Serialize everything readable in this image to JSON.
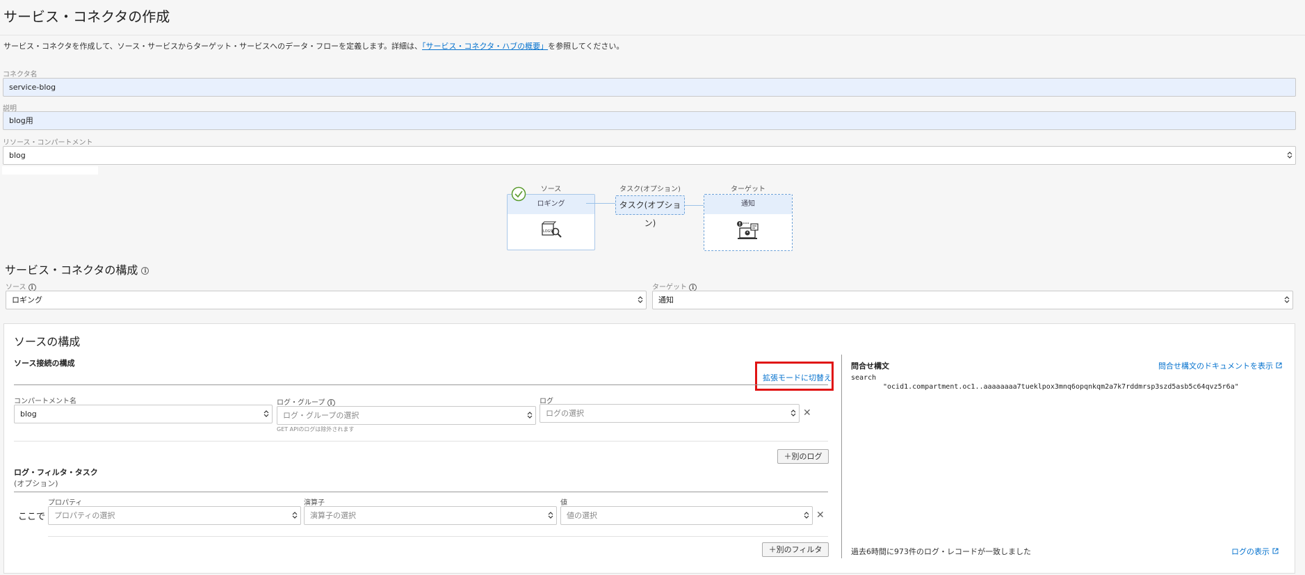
{
  "page": {
    "title": "サービス・コネクタの作成",
    "intro_text": "サービス・コネクタを作成して、ソース・サービスからターゲット・サービスへのデータ・フローを定義します。詳細は、",
    "intro_link": "「サービス・コネクタ・ハブの概要」",
    "intro_suffix": "を参照してください。"
  },
  "form": {
    "connector_name_label": "コネクタ名",
    "connector_name_value": "service-blog",
    "description_label": "説明",
    "description_value": "blog用",
    "compartment_label": "リソース・コンパートメント",
    "compartment_value": "blog"
  },
  "diagram": {
    "source_label": "ソース",
    "source_box": "ロギング",
    "task_label": "タスク(オプション)",
    "task_box": "タスク(オプション)",
    "target_label": "ターゲット",
    "target_box": "通知"
  },
  "config": {
    "heading": "サービス・コネクタの構成",
    "source_label": "ソース",
    "source_value": "ロギング",
    "target_label": "ターゲット",
    "target_value": "通知"
  },
  "source_config": {
    "heading": "ソースの構成",
    "connection_heading": "ソース接続の構成",
    "switch_mode_link": "拡張モードに切替え",
    "compartment_label": "コンパートメント名",
    "compartment_value": "blog",
    "log_group_label": "ログ・グループ",
    "log_group_placeholder": "ログ・グループの選択",
    "log_group_hint": "GET APIのログは除外されます",
    "log_label": "ログ",
    "log_placeholder": "ログの選択",
    "another_log_button": "別のログ",
    "filter_heading": "ログ・フィルタ・タスク",
    "filter_optional": "(オプション)",
    "where_label": "ここで",
    "property_label": "プロパティ",
    "property_placeholder": "プロパティの選択",
    "operator_label": "演算子",
    "operator_placeholder": "演算子の選択",
    "value_label": "値",
    "value_placeholder": "値の選択",
    "another_filter_button": "別のフィルタ"
  },
  "query": {
    "heading": "問合せ構文",
    "docs_link": "問合せ構文のドキュメントを表示",
    "line1": "search",
    "line2": "\"ocid1.compartment.oc1..aaaaaaaa7tueklpox3mnq6opqnkqm2a7k7rddmrsp3szd5asb5c64qvz5r6a\"",
    "match_text": "過去6時間に973件のログ・レコードが一致しました",
    "view_logs_link": "ログの表示"
  },
  "icons": {
    "check": "check-circle-icon",
    "logging": "logging-icon",
    "notification": "notification-icon",
    "external": "external-link-icon"
  }
}
